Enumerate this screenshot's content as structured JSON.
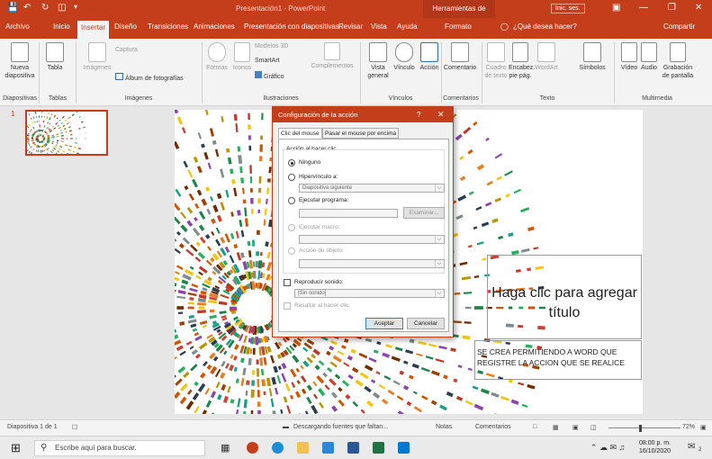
{
  "titlebar": {
    "title": "Presentación1 - PowerPoint",
    "context_tools": "Herramientas de dibujo",
    "signin": "Inic. ses."
  },
  "tabs": [
    "Archivo",
    "Inicio",
    "Insertar",
    "Diseño",
    "Transiciones",
    "Animaciones",
    "Presentación con diapositivas",
    "Revisar",
    "Vista",
    "Ayuda",
    "Formato"
  ],
  "tell_me": "¿Qué desea hacer?",
  "share": "Compartir",
  "ribbon": {
    "nueva": "Nueva diapositiva",
    "tabla": "Tabla",
    "imagenes": "Imágenes",
    "captura": "Captura",
    "album": "Álbum de fotografías",
    "formas": "Formas",
    "iconos": "Iconos",
    "modelos": "Modelos 3D",
    "smartart": "SmartArt",
    "grafico": "Gráfico",
    "complementos": "Complementos",
    "vista": "Vista general",
    "vinculo": "Vínculo",
    "accion": "Acción",
    "comentario": "Comentario",
    "cuadro": "Cuadro de texto",
    "encabez": "Encabez. pie pág.",
    "wordart": "WordArt",
    "simbolos": "Símbolos",
    "video": "Vídeo",
    "audio": "Audio",
    "grabacion": "Grabación de pantalla",
    "groups": [
      "Diapositivas",
      "Tablas",
      "Imágenes",
      "Ilustraciones",
      "Vínculos",
      "Comentarios",
      "Texto",
      "Multimedia"
    ]
  },
  "slides": {
    "number": "1"
  },
  "slide": {
    "title": "Haga clic para agregar título",
    "body": "SE CREA PERMITIENDO A WORD QUE REGISTRE LA ACCION QUE SE REALICE"
  },
  "dialog": {
    "title": "Configuración de la acción",
    "help": "?",
    "tab_click": "Clic del mouse",
    "tab_hover": "Pasar el mouse por encima",
    "section": "Acción al hacer clic",
    "ninguno": "Ninguno",
    "hipervinculo": "Hipervínculo a:",
    "hipervinculo_value": "Diapositiva siguiente",
    "ejecutar": "Ejecutar programa:",
    "examinar": "Examinar...",
    "macro": "Ejecutar macro:",
    "objeto": "Acción de objeto:",
    "sonido": "Reproducir sonido:",
    "sonido_value": "[Sin sonido]",
    "resaltar": "Resaltar al hacer clic",
    "aceptar": "Aceptar",
    "cancelar": "Cancelar"
  },
  "status": {
    "slide": "Diapositiva 1 de 1",
    "loading": "Descargando fuentes que faltan...",
    "notas": "Notas",
    "comentarios": "Comentarios",
    "zoom": "72%"
  },
  "taskbar": {
    "search": "Escribe aquí para buscar.",
    "time": "08:00 p. m.",
    "date": "16/10/2020",
    "notif": "2"
  }
}
